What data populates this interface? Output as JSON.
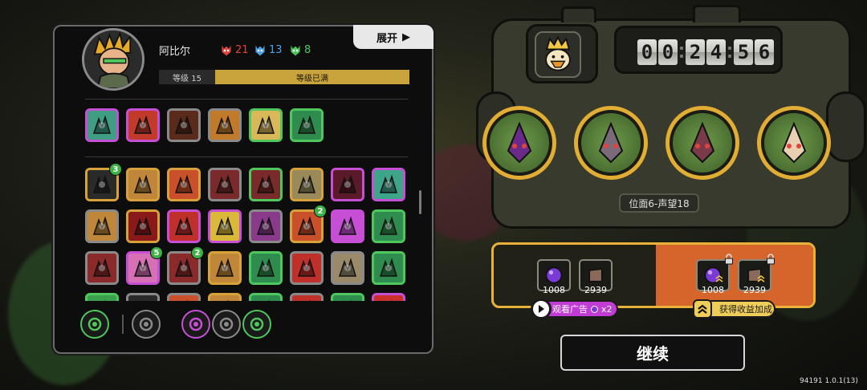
{
  "hero": {
    "name": "阿比尔",
    "stats": [
      {
        "icon": "red-demon-icon",
        "value": "21",
        "color": "#e0443c"
      },
      {
        "icon": "blue-demon-icon",
        "value": "13",
        "color": "#4ea3e8"
      },
      {
        "icon": "green-demon-icon",
        "value": "8",
        "color": "#4fc75c"
      }
    ],
    "expand_label": "展开",
    "level_label": "等级 15",
    "level_status": "等级已满"
  },
  "equipped_skills": [
    {
      "icon": "compass-skill-icon",
      "border": "#c64fd6",
      "bg": "#3e9d83"
    },
    {
      "icon": "explosion-skill-icon",
      "border": "#c64fd6",
      "bg": "#c13a2a"
    },
    {
      "icon": "demon-mask-skill-icon",
      "border": "#8a8a8a",
      "bg": "#5a2a1a"
    },
    {
      "icon": "bomb-skill-icon",
      "border": "#8a8a8a",
      "bg": "#c17a2a"
    },
    {
      "icon": "pillar-skill-icon",
      "border": "#4fc75c",
      "bg": "#d9b85a"
    },
    {
      "icon": "leaf-skill-icon",
      "border": "#4fc75c",
      "bg": "#2e8c4e"
    }
  ],
  "inventory": [
    {
      "icon": "spike-icon",
      "border": "#d8a23a",
      "bg": "#2a2a2a",
      "badge": "3"
    },
    {
      "icon": "rune-icon",
      "border": "#d8a23a",
      "bg": "#c0873a"
    },
    {
      "icon": "flame-icon",
      "border": "#d8a23a",
      "bg": "#c9502a"
    },
    {
      "icon": "claw-icon",
      "border": "#8a8a8a",
      "bg": "#7a2a2a"
    },
    {
      "icon": "tree-icon",
      "border": "#4fc75c",
      "bg": "#7a2a2a"
    },
    {
      "icon": "fence-icon",
      "border": "#d8a23a",
      "bg": "#9a8a5a"
    },
    {
      "icon": "fangs-icon",
      "border": "#c64fd6",
      "bg": "#5a1a2a"
    },
    {
      "icon": "vortex-icon",
      "border": "#c64fd6",
      "bg": "#3ea58a"
    },
    {
      "icon": "chain-icon",
      "border": "#8a8a8a",
      "bg": "#c0873a"
    },
    {
      "icon": "tooth-icon",
      "border": "#d8a23a",
      "bg": "#8a1a1a"
    },
    {
      "icon": "beast-icon",
      "border": "#c64fd6",
      "bg": "#c0302a"
    },
    {
      "icon": "scroll-icon",
      "border": "#c64fd6",
      "bg": "#d9b83a"
    },
    {
      "icon": "face-icon",
      "border": "#8a8a8a",
      "bg": "#8a3a8a"
    },
    {
      "icon": "crack-icon",
      "border": "#d8a23a",
      "bg": "#c9502a",
      "badge": "2"
    },
    {
      "icon": "book-icon",
      "border": "#c64fd6",
      "bg": "#c64fd6"
    },
    {
      "icon": "thorns-icon",
      "border": "#4fc75c",
      "bg": "#2e8c4e"
    },
    {
      "icon": "axe-icon",
      "border": "#8a8a8a",
      "bg": "#8a2a2a"
    },
    {
      "icon": "gem-icon",
      "border": "#c64fd6",
      "bg": "#d870b6",
      "badge": "5"
    },
    {
      "icon": "swords-icon",
      "border": "#8a8a8a",
      "bg": "#8a2a2a",
      "badge": "2"
    },
    {
      "icon": "sun-icon",
      "border": "#d8a23a",
      "bg": "#c0873a"
    },
    {
      "icon": "shards-icon",
      "border": "#4fc75c",
      "bg": "#2e8c4e"
    },
    {
      "icon": "wave-icon",
      "border": "#8a8a8a",
      "bg": "#c0302a"
    },
    {
      "icon": "shield-icon",
      "border": "#8a8a8a",
      "bg": "#9a8a6a"
    },
    {
      "icon": "grass-icon",
      "border": "#4fc75c",
      "bg": "#2e8c4e"
    },
    {
      "icon": "tree-arrow-icon",
      "border": "#4fc75c",
      "bg": "#3aa04e"
    },
    {
      "icon": "partial-1-icon",
      "border": "#8a8a8a",
      "bg": "#2a2a2a"
    },
    {
      "icon": "partial-2-icon",
      "border": "#8a8a8a",
      "bg": "#c9502a"
    },
    {
      "icon": "partial-3-icon",
      "border": "#d8a23a",
      "bg": "#c0873a"
    },
    {
      "icon": "partial-4-icon",
      "border": "#4fc75c",
      "bg": "#2e8c4e"
    },
    {
      "icon": "partial-5-icon",
      "border": "#8a8a8a",
      "bg": "#c0302a"
    },
    {
      "icon": "partial-6-icon",
      "border": "#4fc75c",
      "bg": "#2e8c4e"
    },
    {
      "icon": "partial-7-icon",
      "border": "#c64fd6",
      "bg": "#c9302a"
    },
    {
      "icon": "partial-8-icon",
      "border": "#8a8a8a",
      "bg": "#2a2a2a"
    }
  ],
  "bottom_filters": [
    {
      "icon": "all-filter-icon",
      "border": "#4fc75c"
    },
    {
      "icon": "lightning-filter-icon",
      "border": "#8a8a8a"
    },
    {
      "icon": "orb-filter-icon",
      "border": "#c64fd6"
    },
    {
      "icon": "swirl-filter-icon",
      "border": "#8a8a8a"
    },
    {
      "icon": "scroll-filter-icon",
      "border": "#4fc75c"
    }
  ],
  "timer": {
    "digits": [
      "0",
      "0",
      "2",
      "4",
      "5",
      "6"
    ]
  },
  "slots": [
    {
      "icon": "purple-creature-icon"
    },
    {
      "icon": "mech-mask-icon"
    },
    {
      "icon": "red-claw-creature-icon"
    },
    {
      "icon": "glasses-guy-icon"
    }
  ],
  "stage_label": "位面6-声望18",
  "rewards": {
    "left": [
      {
        "icon": "purple-orb-icon",
        "count": "1008"
      },
      {
        "icon": "stone-tablet-icon",
        "count": "2939"
      }
    ],
    "right": [
      {
        "icon": "purple-orb-icon",
        "count": "1008"
      },
      {
        "icon": "stone-tablet-icon",
        "count": "2939"
      }
    ]
  },
  "ad_button": {
    "label": "观看广告",
    "multiplier": "x2"
  },
  "bonus_button": {
    "label": "获得收益加成"
  },
  "continue_label": "继续",
  "version": "94191 1.0.1(13)"
}
